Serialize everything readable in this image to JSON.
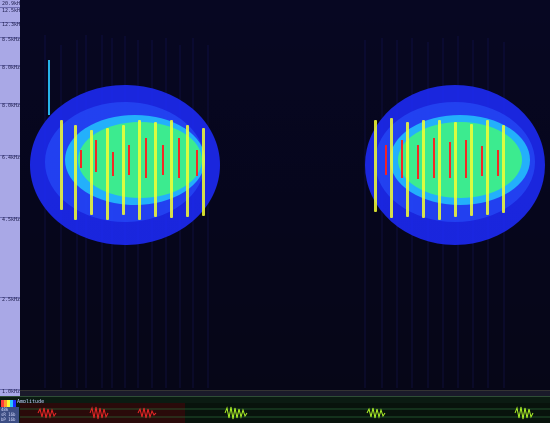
{
  "ruler": {
    "labels": [
      "20.9kHz",
      "12.5kHz",
      "12.3kHz",
      "8.5kHz",
      "8.0kHz",
      "8.0kHz",
      "6.4kHz",
      "4.5kHz",
      "2.5kHz",
      "1.0kHz"
    ]
  },
  "amplitude": {
    "label": "Amplitude"
  },
  "lower_left": {
    "line1": "48k",
    "line2": "sR 16b",
    "line3": "bP 16b"
  },
  "colors": {
    "background": "#060617",
    "ruler": "#a9a8e6",
    "hot": "#ff2020",
    "mid": "#f6ff32",
    "cool": "#2ac6ff"
  }
}
